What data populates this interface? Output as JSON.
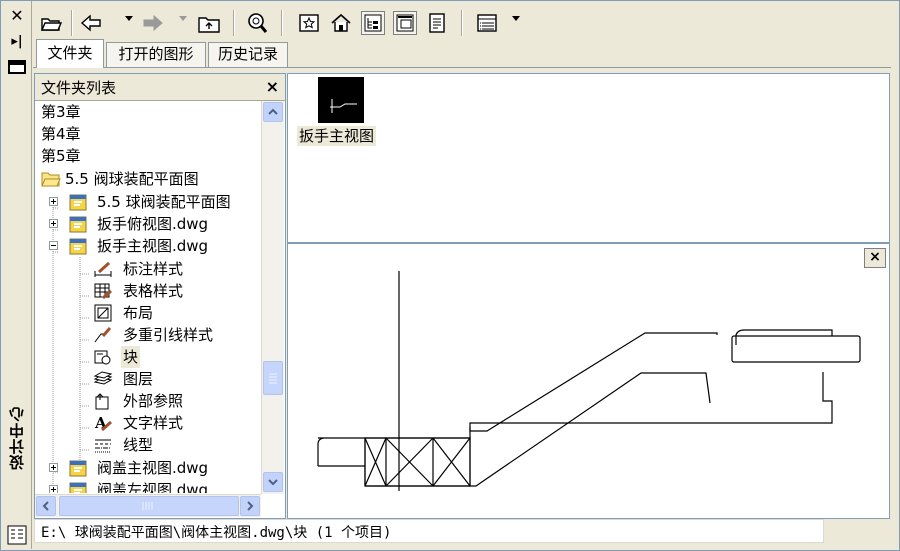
{
  "palette": {
    "title": "设计中心"
  },
  "toolbar": {
    "buttons": [
      "load-icon",
      "back-icon",
      "forward-icon",
      "up-icon",
      "search-icon",
      "favorites-icon",
      "home-icon",
      "tree-toggle-icon",
      "preview-icon",
      "description-icon",
      "views-icon"
    ]
  },
  "tabs": [
    {
      "label": "文件夹",
      "active": true
    },
    {
      "label": "打开的图形",
      "active": false
    },
    {
      "label": "历史记录",
      "active": false
    }
  ],
  "folder_panel": {
    "title": "文件夹列表",
    "close": "×",
    "items": [
      {
        "label": "第3章"
      },
      {
        "label": "第4章"
      },
      {
        "label": "第5章"
      },
      {
        "label": "5.5 阀球装配平面图"
      },
      {
        "label": "5.5  球阀装配平面图"
      },
      {
        "label": "扳手俯视图.dwg"
      },
      {
        "label": "扳手主视图.dwg"
      },
      {
        "label": "标注样式"
      },
      {
        "label": "表格样式"
      },
      {
        "label": "布局"
      },
      {
        "label": "多重引线样式"
      },
      {
        "label": "块"
      },
      {
        "label": "图层"
      },
      {
        "label": "外部参照"
      },
      {
        "label": "文字样式"
      },
      {
        "label": "线型"
      },
      {
        "label": "阀盖主视图.dwg"
      },
      {
        "label": "阀盖左视图.dwg"
      }
    ]
  },
  "content": {
    "items": [
      {
        "label": "扳手主视图"
      }
    ]
  },
  "preview": {
    "close": "×"
  },
  "status": {
    "text": "E:\\ 球阀装配平面图\\阀体主视图.dwg\\块 (1 个项目)"
  }
}
